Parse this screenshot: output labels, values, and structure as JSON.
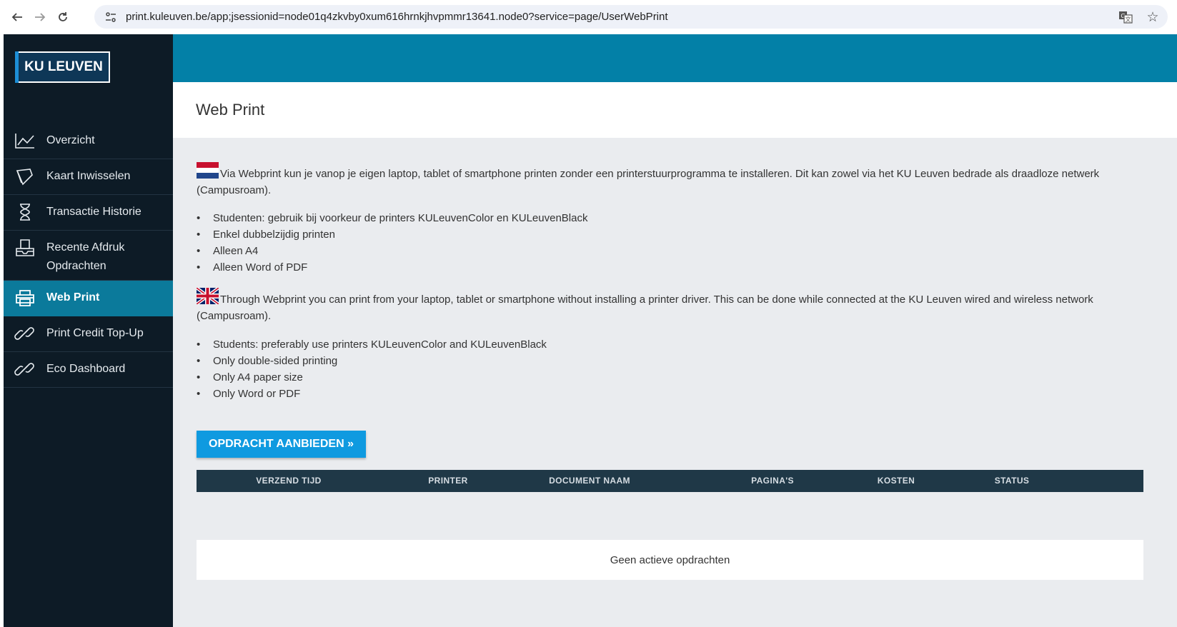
{
  "browser": {
    "url": "print.kuleuven.be/app;jsessionid=node01q4zkvby0xum616hrnkjhvpmmr13641.node0?service=page/UserWebPrint",
    "icons": [
      "back-arrow-icon",
      "forward-arrow-icon",
      "reload-icon",
      "site-settings-icon",
      "translate-icon",
      "bookmark-star-icon"
    ]
  },
  "logo": {
    "text": "KU LEUVEN"
  },
  "sidebar": {
    "items": [
      {
        "label": "Overzicht",
        "icon": "chart-line-icon",
        "active": false
      },
      {
        "label": "Kaart Inwisselen",
        "icon": "card-icon",
        "active": false
      },
      {
        "label": "Transactie Historie",
        "icon": "hourglass-icon",
        "active": false
      },
      {
        "label": "Recente Afdruk",
        "label2": "Opdrachten",
        "icon": "print-tray-icon",
        "active": false
      },
      {
        "label": "Web Print",
        "icon": "printer-icon",
        "active": true
      },
      {
        "label": "Print Credit Top-Up",
        "icon": "link-icon",
        "active": false
      },
      {
        "label": "Eco Dashboard",
        "icon": "link-icon",
        "active": false
      }
    ]
  },
  "page": {
    "title": "Web Print"
  },
  "nl": {
    "intro": "Via Webprint kun je vanop je eigen laptop, tablet of smartphone printen zonder een printerstuurprogramma te installeren. Dit kan zowel via het KU Leuven bedrade als draadloze netwerk (Campusroam).",
    "bullets": [
      "Studenten: gebruik bij voorkeur de printers KULeuvenColor en KULeuvenBlack",
      "Enkel dubbelzijdig printen",
      "Alleen A4",
      "Alleen Word of PDF"
    ]
  },
  "en": {
    "intro": "Through Webprint you can print from your laptop, tablet or smartphone without installing a printer driver. This can be done while connected at the KU Leuven wired and wireless network (Campusroam).",
    "bullets": [
      "Students: preferably use printers KULeuvenColor and KULeuvenBlack",
      "Only double-sided printing",
      "Only A4 paper size",
      "Only Word or PDF"
    ]
  },
  "submit_button": "OPDRACHT AANBIEDEN »",
  "table": {
    "columns": [
      "VERZEND TIJD",
      "PRINTER",
      "DOCUMENT NAAM",
      "PAGINA'S",
      "KOSTEN",
      "STATUS"
    ],
    "empty_message": "Geen actieve opdrachten"
  },
  "colors": {
    "sidebar_bg": "#0d1b26",
    "active_item": "#0b7a9b",
    "topbar": "#0380a7",
    "button": "#0f9ae0",
    "table_header": "#1f3847",
    "content_bg": "#eaecef"
  }
}
